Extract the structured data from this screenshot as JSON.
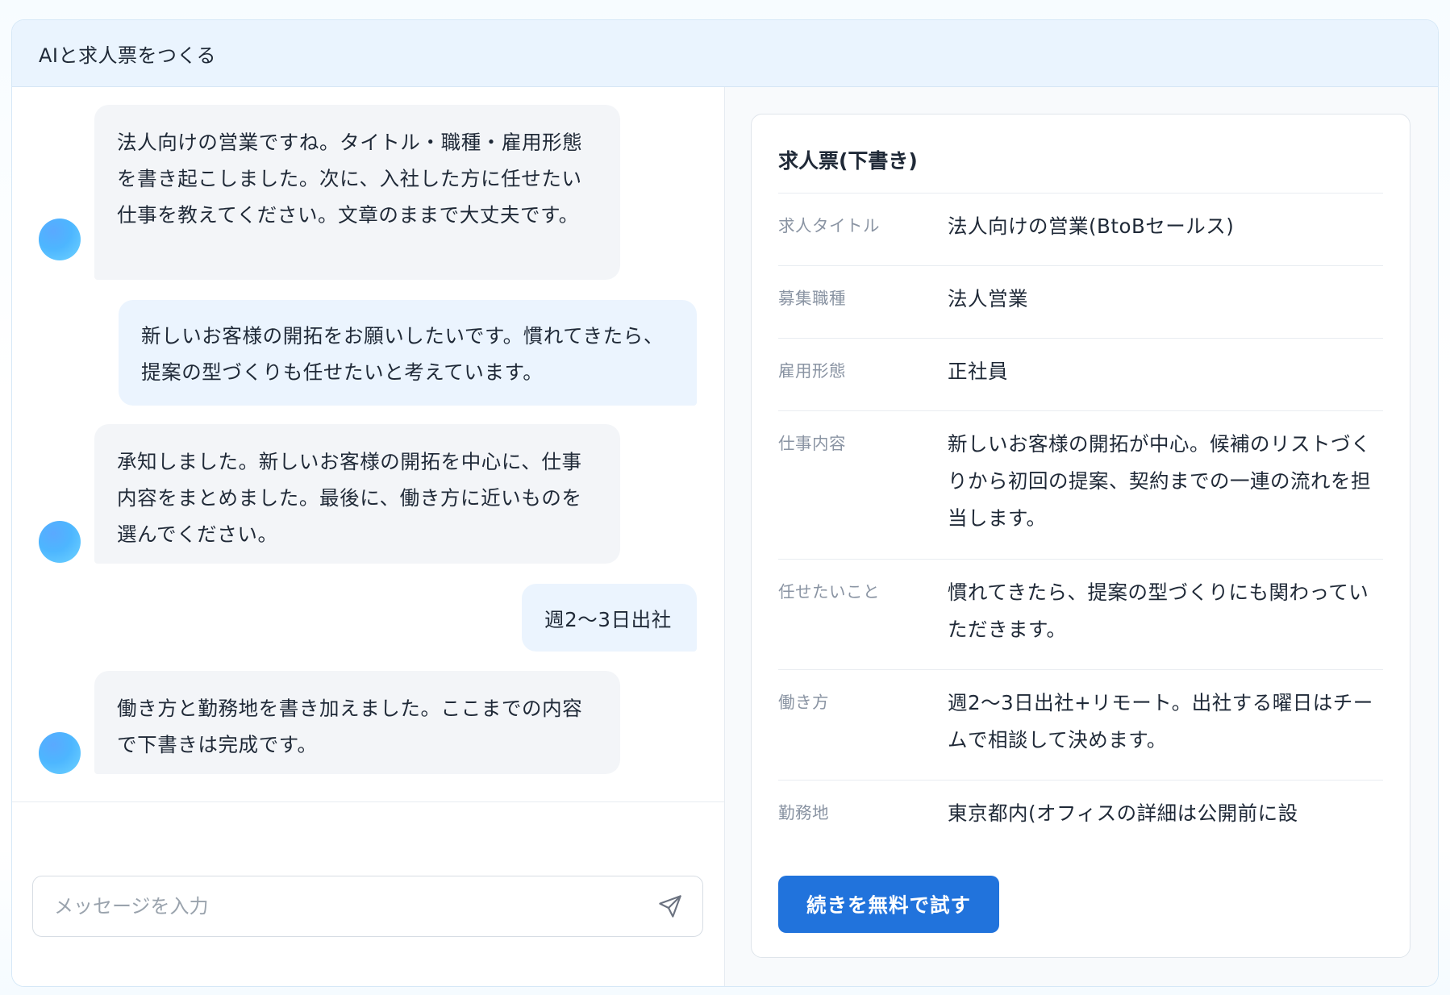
{
  "header": {
    "title": "AIと求人票をつくる"
  },
  "chat": {
    "messages": [
      {
        "role": "ai",
        "text": "法人向けの営業ですね。タイトル・職種・雇用形態を書き起こしました。次に、入社した方に任せたい仕事を教えてください。文章のままで大丈夫です。"
      },
      {
        "role": "user",
        "text": "新しいお客様の開拓をお願いしたいです。慣れてきたら、提案の型づくりも任せたいと考えています。"
      },
      {
        "role": "ai",
        "text": "承知しました。新しいお客様の開拓を中心に、仕事内容をまとめました。最後に、働き方に近いものを選んでください。"
      },
      {
        "role": "user",
        "text": "週2〜3日出社"
      },
      {
        "role": "ai",
        "text": "働き方と勤務地を書き加えました。ここまでの内容で下書きは完成です。"
      }
    ],
    "composer": {
      "placeholder": "メッセージを入力",
      "send_icon": "paper-plane-icon"
    }
  },
  "draft": {
    "title": "求人票(下書き)",
    "fields": [
      {
        "label": "求人タイトル",
        "value": "法人向けの営業(BtoBセールス)"
      },
      {
        "label": "募集職種",
        "value": "法人営業"
      },
      {
        "label": "雇用形態",
        "value": "正社員"
      },
      {
        "label": "仕事内容",
        "value": "新しいお客様の開拓が中心。候補のリストづくりから初回の提案、契約までの一連の流れを担当します。"
      },
      {
        "label": "任せたいこと",
        "value": "慣れてきたら、提案の型づくりにも関わっていただきます。"
      },
      {
        "label": "働き方",
        "value": "週2〜3日出社+リモート。出社する曜日はチームで相談して決めます。"
      },
      {
        "label": "勤務地",
        "value": "東京都内(オフィスの詳細は公開前に設"
      }
    ],
    "cta_label": "続きを無料で試す"
  },
  "colors": {
    "accent": "#2173dc",
    "header_bg": "#eaf4fe",
    "ai_bubble": "#f3f5f8",
    "user_bubble": "#ebf4fe"
  }
}
